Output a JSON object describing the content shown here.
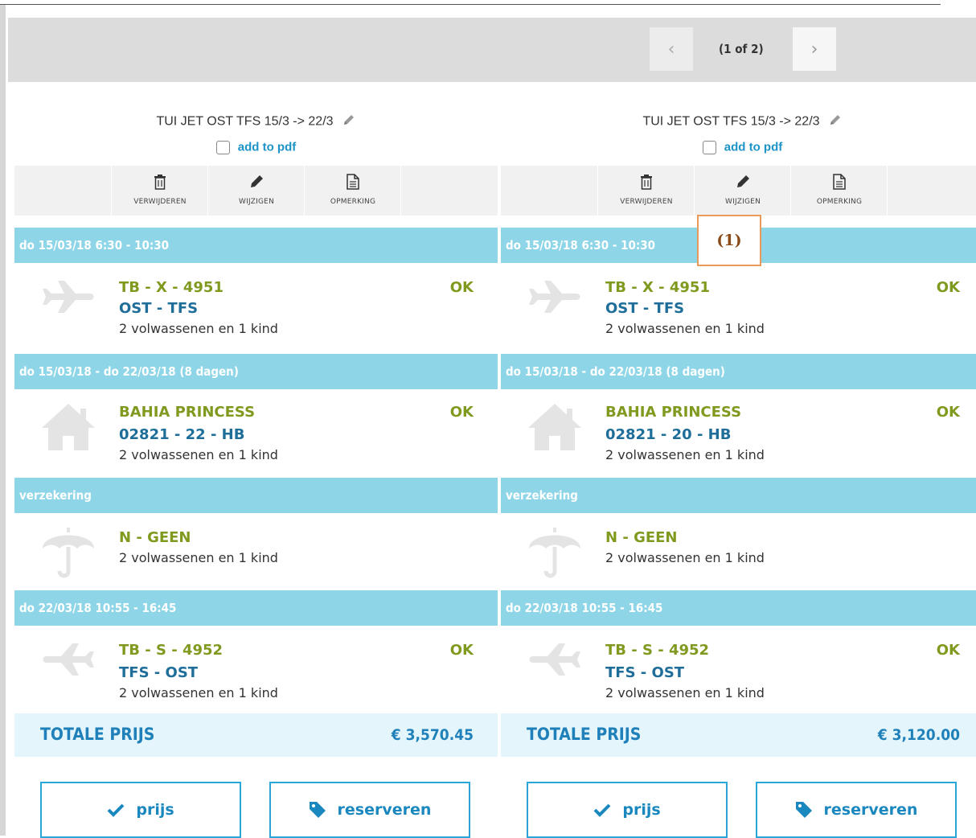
{
  "pager": {
    "prev": "‹",
    "count": "(1 of 2)",
    "next": "›"
  },
  "columns": [
    {
      "title": "TUI JET OST TFS 15/3 -> 22/3",
      "add_pdf": "add to pdf",
      "tools": {
        "delete": "VERWIJDEREN",
        "edit": "WIJZIGEN",
        "note": "OPMERKING"
      },
      "flight_out": {
        "header": "do 15/03/18 6:30 - 10:30",
        "code": "TB - X - 4951",
        "route": "OST - TFS",
        "pax": "2 volwassenen en 1 kind",
        "status": "OK"
      },
      "hotel": {
        "header": "do 15/03/18 - do 22/03/18 (8 dagen)",
        "name": "BAHIA PRINCESS",
        "code": "02821 - 22 - HB",
        "pax": "2 volwassenen en 1 kind",
        "status": "OK"
      },
      "insurance": {
        "header": "verzekering",
        "code": "N - GEEN",
        "pax": "2 volwassenen en 1 kind"
      },
      "flight_back": {
        "header": "do 22/03/18 10:55 - 16:45",
        "code": "TB - S - 4952",
        "route": "TFS - OST",
        "pax": "2 volwassenen en 1 kind",
        "status": "OK"
      },
      "total": {
        "label": "TOTALE PRIJS",
        "value": "€ 3,570.45"
      },
      "buttons": {
        "price": "prijs",
        "reserve": "reserveren"
      }
    },
    {
      "title": "TUI JET OST TFS 15/3 -> 22/3",
      "add_pdf": "add to pdf",
      "tools": {
        "delete": "VERWIJDEREN",
        "edit": "WIJZIGEN",
        "note": "OPMERKING"
      },
      "flight_out": {
        "header": "do 15/03/18 6:30 - 10:30",
        "code": "TB - X - 4951",
        "route": "OST - TFS",
        "pax": "2 volwassenen en 1 kind",
        "status": "OK"
      },
      "hotel": {
        "header": "do 15/03/18 - do 22/03/18 (8 dagen)",
        "name": "BAHIA PRINCESS",
        "code": "02821 - 20 - HB",
        "pax": "2 volwassenen en 1 kind",
        "status": "OK"
      },
      "insurance": {
        "header": "verzekering",
        "code": "N - GEEN",
        "pax": "2 volwassenen en 1 kind"
      },
      "flight_back": {
        "header": "do 22/03/18 10:55 - 16:45",
        "code": "TB - S - 4952",
        "route": "TFS - OST",
        "pax": "2 volwassenen en 1 kind",
        "status": "OK"
      },
      "total": {
        "label": "TOTALE PRIJS",
        "value": "€ 3,120.00"
      },
      "buttons": {
        "price": "prijs",
        "reserve": "reserveren"
      }
    }
  ],
  "annotation": "(1)",
  "colors": {
    "band": "#8ed6e7",
    "green": "#7f9a1e",
    "blue": "#1f6e9a",
    "accent": "#2aa7d8"
  }
}
